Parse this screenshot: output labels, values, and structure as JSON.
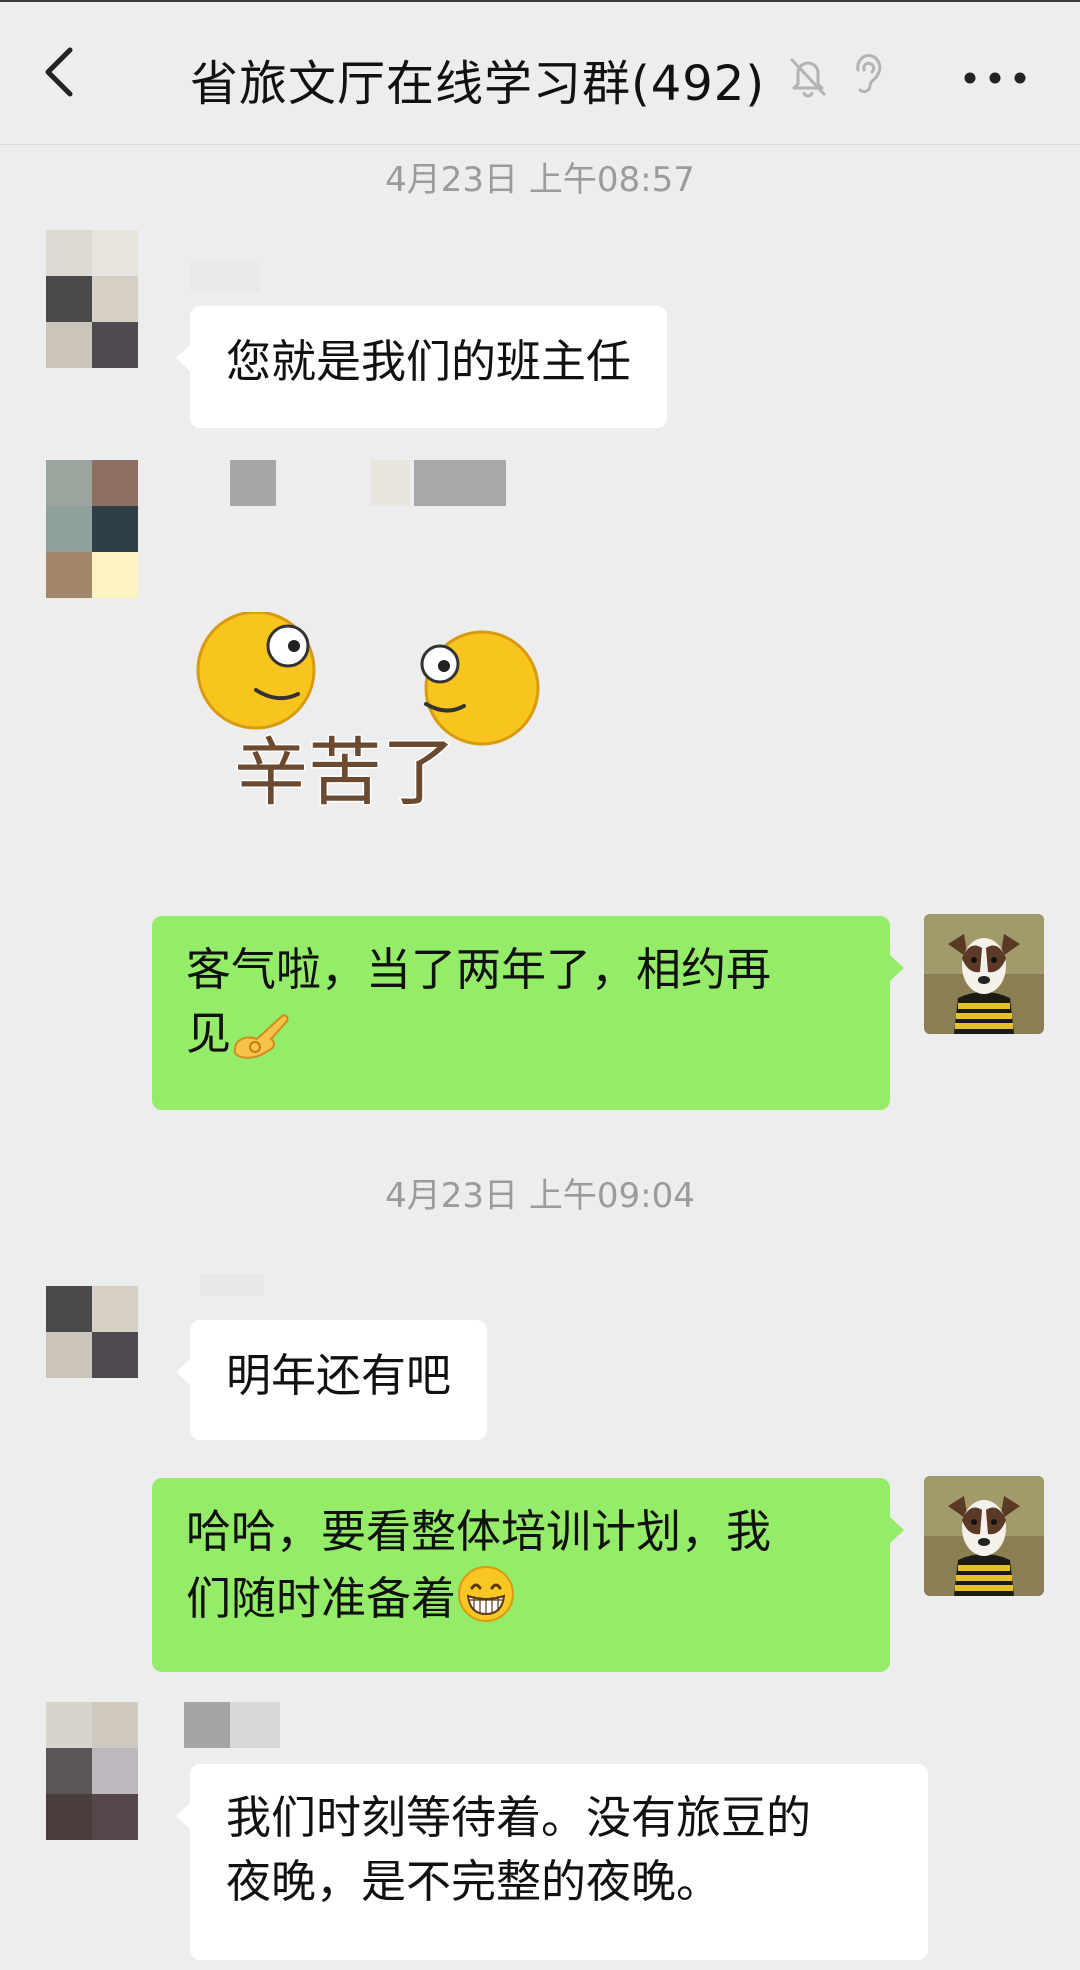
{
  "header": {
    "title": "省旅文厅在线学习群(492)",
    "back_icon": "chevron-left-icon",
    "mute_icon": "bell-off-icon",
    "ear_icon": "earpiece-icon",
    "more_icon": "ellipsis-icon"
  },
  "timestamps": {
    "t1": "4月23日 上午08:57",
    "t2": "4月23日 上午09:04"
  },
  "messages": [
    {
      "side": "left",
      "text": "您就是我们的班主任"
    },
    {
      "side": "left",
      "type": "sticker",
      "sticker_text": "辛苦了"
    },
    {
      "side": "right",
      "line1": "客气啦，当了两年了，相约再",
      "line2": "见",
      "emoji": "ok-hand-emoji"
    },
    {
      "side": "left",
      "text": "明年还有吧"
    },
    {
      "side": "right",
      "line1": "哈哈，要看整体培训计划，我",
      "line2": "们随时准备着",
      "emoji": "grinning-face-emoji"
    },
    {
      "side": "left",
      "line1": "我们时刻等待着。没有旅豆的",
      "line2": "夜晚，是不完整的夜晚。"
    }
  ],
  "colors": {
    "background": "#ededed",
    "own_bubble": "#95ec69",
    "other_bubble": "#ffffff",
    "timestamp": "#9b9b9b"
  }
}
